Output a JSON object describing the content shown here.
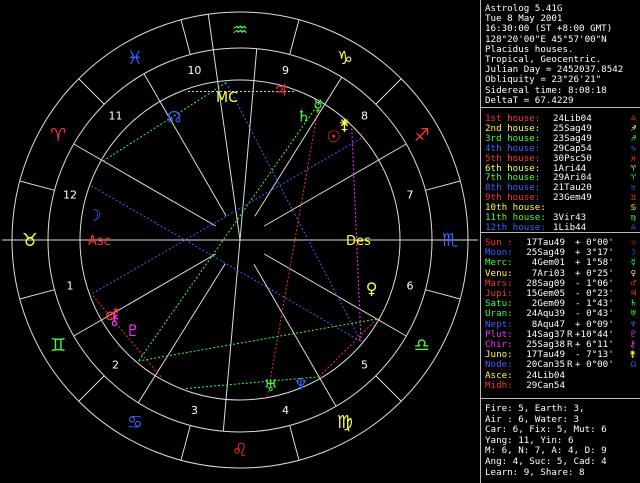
{
  "info": {
    "lines": [
      "Astrolog 5.41G",
      "Tue 8 May 2001",
      "16:30:00 (ST +8:00 GMT)",
      "128°20'00\"E 45°57'00\"N",
      "Placidus houses.",
      "Tropical, Geocentric.",
      "Julian Day = 2452037.8542",
      "Obliquity = 23°26'21\"",
      "Sidereal time: 8:08:18",
      "DeltaT = 67.4229"
    ]
  },
  "houses": [
    {
      "label": "1st house:",
      "value": "24Lib04",
      "color": "#ff3030",
      "sym": "♎"
    },
    {
      "label": "2nd house:",
      "value": "25Sag49",
      "color": "#ffff40",
      "sym": "♐"
    },
    {
      "label": "3rd house:",
      "value": "23Sag49",
      "color": "#40ff40",
      "sym": "♐"
    },
    {
      "label": "4th house:",
      "value": "29Cap54",
      "color": "#4060ff",
      "sym": "♑"
    },
    {
      "label": "5th house:",
      "value": "30Psc50",
      "color": "#ff3030",
      "sym": "♓"
    },
    {
      "label": "6th house:",
      "value": "1Ari44",
      "color": "#ffff40",
      "sym": "♈"
    },
    {
      "label": "7th house:",
      "value": "29Ari04",
      "color": "#40ff40",
      "sym": "♈"
    },
    {
      "label": "8th house:",
      "value": "21Tau20",
      "color": "#4060ff",
      "sym": "♉"
    },
    {
      "label": "9th house:",
      "value": "23Gem49",
      "color": "#ff3030",
      "sym": "♊"
    },
    {
      "label": "10th house:",
      "value": "",
      "color": "#ffff40",
      "sym": "♋"
    },
    {
      "label": "11th house:",
      "value": "3Vir43",
      "color": "#40ff40",
      "sym": "♍"
    },
    {
      "label": "12th house:",
      "value": "1Lib44",
      "color": "#4060ff",
      "sym": "♎"
    }
  ],
  "planets": [
    {
      "label": "Sun :",
      "pos": "17Tau49",
      "ret": "",
      "lat": "+ 0°00'",
      "color": "#ff3030",
      "sym": "☉"
    },
    {
      "label": "Moon:",
      "pos": "25Sag49",
      "ret": "",
      "lat": "+ 3°17'",
      "color": "#4060ff",
      "sym": "☽"
    },
    {
      "label": "Merc:",
      "pos": "4Gem01",
      "ret": "",
      "lat": "+ 1°58'",
      "color": "#40ff40",
      "sym": "☿"
    },
    {
      "label": "Venu:",
      "pos": "7Ari03",
      "ret": "",
      "lat": "+ 0°25'",
      "color": "#ffff40",
      "sym": "♀"
    },
    {
      "label": "Mars:",
      "pos": "28Sag09",
      "ret": "",
      "lat": "- 1°06'",
      "color": "#ff3030",
      "sym": "♂"
    },
    {
      "label": "Jupi:",
      "pos": "15Gem05",
      "ret": "",
      "lat": "- 0°23'",
      "color": "#ff3030",
      "sym": "♃"
    },
    {
      "label": "Satu:",
      "pos": "2Gem09",
      "ret": "",
      "lat": "- 1°43'",
      "color": "#40ff40",
      "sym": "♄"
    },
    {
      "label": "Uran:",
      "pos": "24Aqu39",
      "ret": "",
      "lat": "- 0°43'",
      "color": "#40ff40",
      "sym": "♅"
    },
    {
      "label": "Nept:",
      "pos": "8Aqu47",
      "ret": "",
      "lat": "+ 0°09'",
      "color": "#4060ff",
      "sym": "♆"
    },
    {
      "label": "Plut:",
      "pos": "14Sag37",
      "ret": "R",
      "lat": "+10°44'",
      "color": "#ff30ff",
      "sym": "♇"
    },
    {
      "label": "Chir:",
      "pos": "25Sag38",
      "ret": "R",
      "lat": "+ 6°11'",
      "color": "#ff30ff",
      "sym": "⚷"
    },
    {
      "label": "Juno:",
      "pos": "17Tau49",
      "ret": "",
      "lat": "- 7°13'",
      "color": "#ffff40",
      "sym": "⚵"
    },
    {
      "label": "Node:",
      "pos": "20Can35",
      "ret": "R",
      "lat": "+ 0°00'",
      "color": "#4060ff",
      "sym": "☊"
    },
    {
      "label": "Asce:",
      "pos": "24Lib04",
      "ret": "",
      "lat": "",
      "color": "#ffff40",
      "sym": ""
    },
    {
      "label": "Midh:",
      "pos": "29Can54",
      "ret": "",
      "lat": "",
      "color": "#ff3030",
      "sym": ""
    }
  ],
  "stats": [
    "Fire: 5, Earth: 3,",
    "Air : 6, Water: 3",
    "Car: 6, Fix: 5, Mut: 6",
    "Yang: 11, Yin: 6",
    "M: 6, N: 7, A: 4, D: 9",
    "Ang: 4, Suc: 5, Cad: 4",
    "Learn: 9, Share: 8"
  ],
  "wheel": {
    "asc_label": "Asc",
    "des_label": "Des",
    "mc_label": "MC",
    "ic_label": "IC",
    "house_numbers": [
      "1",
      "2",
      "3",
      "4",
      "5",
      "6",
      "7",
      "8",
      "9",
      "10",
      "11",
      "12"
    ],
    "signs": [
      "♈",
      "♉",
      "♊",
      "♋",
      "♌",
      "♍",
      "♎",
      "♏",
      "♐",
      "♑",
      "♒",
      "♓"
    ]
  }
}
